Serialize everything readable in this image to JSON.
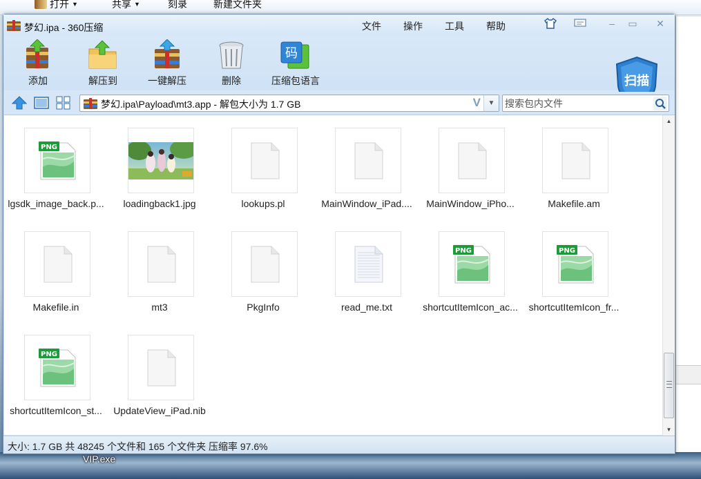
{
  "explorer_bar": {
    "open_label": "打开",
    "share_label": "共享",
    "burn_label": "刻录",
    "new_folder_label": "新建文件夹"
  },
  "window": {
    "title": "梦幻.ipa - 360压缩",
    "menu": {
      "file": "文件",
      "operation": "操作",
      "tools": "工具",
      "help": "帮助"
    }
  },
  "toolbar": {
    "add": "添加",
    "extract_to": "解压到",
    "one_click_extract": "一键解压",
    "delete": "删除",
    "archive_language": "压缩包语言",
    "scan": "扫描",
    "code_char": "码"
  },
  "address": {
    "path": "梦幻.ipa\\Payload\\mt3.app - 解包大小为 1.7 GB",
    "v_mark": "V"
  },
  "search": {
    "placeholder": "搜索包内文件"
  },
  "files": [
    {
      "name": "lgsdk_image_back.p...",
      "type": "png"
    },
    {
      "name": "loadingback1.jpg",
      "type": "jpg"
    },
    {
      "name": "lookups.pl",
      "type": "blank"
    },
    {
      "name": "MainWindow_iPad....",
      "type": "blank"
    },
    {
      "name": "MainWindow_iPho...",
      "type": "blank"
    },
    {
      "name": "Makefile.am",
      "type": "blank"
    },
    {
      "name": "Makefile.in",
      "type": "blank"
    },
    {
      "name": "mt3",
      "type": "blank"
    },
    {
      "name": "PkgInfo",
      "type": "blank"
    },
    {
      "name": "read_me.txt",
      "type": "txt"
    },
    {
      "name": "shortcutItemIcon_ac...",
      "type": "png"
    },
    {
      "name": "shortcutItemIcon_fr...",
      "type": "png"
    },
    {
      "name": "shortcutItemIcon_st...",
      "type": "png"
    },
    {
      "name": "UpdateView_iPad.nib",
      "type": "blank"
    }
  ],
  "png_badge": "PNG",
  "status": {
    "text": "大小: 1.7 GB 共 48245 个文件和 165 个文件夹 压缩率 97.6%"
  },
  "desktop": {
    "vip_label": "VIP.exe"
  },
  "colors": {
    "window_bg": "#d6e6f6",
    "png_badge_green": "#1f9a3a",
    "scan_shield_blue": "#2f7fd0"
  }
}
